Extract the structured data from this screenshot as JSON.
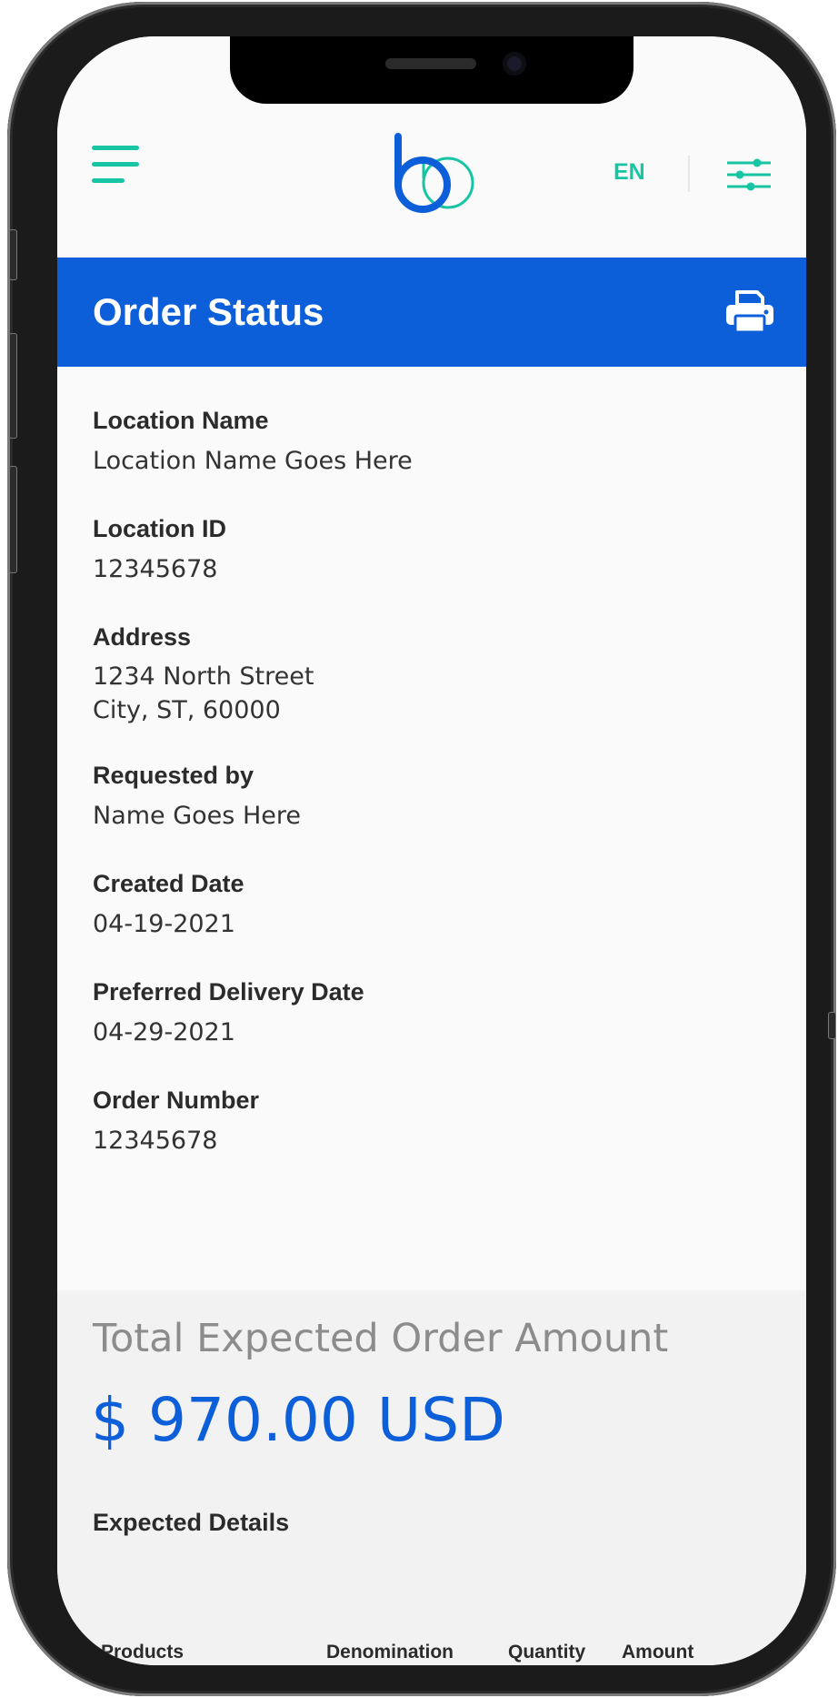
{
  "nav": {
    "menu_icon": "hamburger-menu-icon",
    "logo_icon": "brand-logo",
    "language": "EN",
    "filter_icon": "sliders-settings-icon",
    "accent_color": "#17c5a4"
  },
  "header": {
    "title": "Order Status",
    "print_icon": "printer-icon",
    "background_color": "#0c5fd9"
  },
  "details": [
    {
      "label": "Location Name",
      "value": "Location Name Goes Here"
    },
    {
      "label": "Location ID",
      "value": "12345678"
    },
    {
      "label": "Address",
      "value_lines": [
        "1234 North Street",
        "City, ST, 60000"
      ]
    },
    {
      "label": "Requested by",
      "value": "Name Goes Here"
    },
    {
      "label": "Created Date",
      "value": "04-19-2021"
    },
    {
      "label": "Preferred Delivery Date",
      "value": "04-29-2021"
    },
    {
      "label": "Order Number",
      "value": "12345678"
    }
  ],
  "summary": {
    "total_label": "Total Expected Order Amount",
    "total_value": "$ 970.00 USD",
    "expected_title": "Expected Details",
    "columns": [
      "Products",
      "Denomination",
      "Quantity",
      "Amount"
    ]
  }
}
